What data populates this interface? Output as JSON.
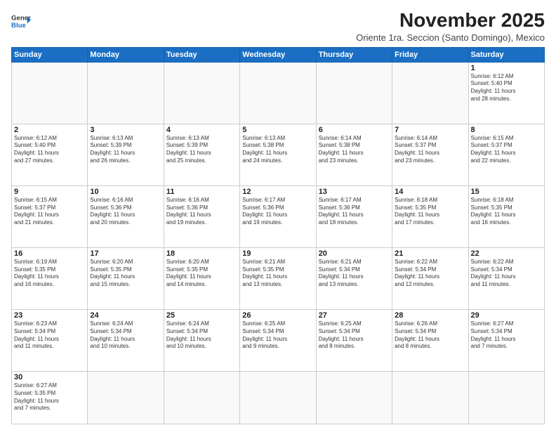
{
  "header": {
    "logo_general": "General",
    "logo_blue": "Blue",
    "title": "November 2025",
    "subtitle": "Oriente 1ra. Seccion (Santo Domingo), Mexico"
  },
  "weekdays": [
    "Sunday",
    "Monday",
    "Tuesday",
    "Wednesday",
    "Thursday",
    "Friday",
    "Saturday"
  ],
  "weeks": [
    [
      {
        "day": "",
        "info": ""
      },
      {
        "day": "",
        "info": ""
      },
      {
        "day": "",
        "info": ""
      },
      {
        "day": "",
        "info": ""
      },
      {
        "day": "",
        "info": ""
      },
      {
        "day": "",
        "info": ""
      },
      {
        "day": "1",
        "info": "Sunrise: 6:12 AM\nSunset: 5:40 PM\nDaylight: 11 hours\nand 28 minutes."
      }
    ],
    [
      {
        "day": "2",
        "info": "Sunrise: 6:12 AM\nSunset: 5:40 PM\nDaylight: 11 hours\nand 27 minutes."
      },
      {
        "day": "3",
        "info": "Sunrise: 6:13 AM\nSunset: 5:39 PM\nDaylight: 11 hours\nand 26 minutes."
      },
      {
        "day": "4",
        "info": "Sunrise: 6:13 AM\nSunset: 5:39 PM\nDaylight: 11 hours\nand 25 minutes."
      },
      {
        "day": "5",
        "info": "Sunrise: 6:13 AM\nSunset: 5:38 PM\nDaylight: 11 hours\nand 24 minutes."
      },
      {
        "day": "6",
        "info": "Sunrise: 6:14 AM\nSunset: 5:38 PM\nDaylight: 11 hours\nand 23 minutes."
      },
      {
        "day": "7",
        "info": "Sunrise: 6:14 AM\nSunset: 5:37 PM\nDaylight: 11 hours\nand 23 minutes."
      },
      {
        "day": "8",
        "info": "Sunrise: 6:15 AM\nSunset: 5:37 PM\nDaylight: 11 hours\nand 22 minutes."
      }
    ],
    [
      {
        "day": "9",
        "info": "Sunrise: 6:15 AM\nSunset: 5:37 PM\nDaylight: 11 hours\nand 21 minutes."
      },
      {
        "day": "10",
        "info": "Sunrise: 6:16 AM\nSunset: 5:36 PM\nDaylight: 11 hours\nand 20 minutes."
      },
      {
        "day": "11",
        "info": "Sunrise: 6:16 AM\nSunset: 5:36 PM\nDaylight: 11 hours\nand 19 minutes."
      },
      {
        "day": "12",
        "info": "Sunrise: 6:17 AM\nSunset: 5:36 PM\nDaylight: 11 hours\nand 19 minutes."
      },
      {
        "day": "13",
        "info": "Sunrise: 6:17 AM\nSunset: 5:36 PM\nDaylight: 11 hours\nand 18 minutes."
      },
      {
        "day": "14",
        "info": "Sunrise: 6:18 AM\nSunset: 5:35 PM\nDaylight: 11 hours\nand 17 minutes."
      },
      {
        "day": "15",
        "info": "Sunrise: 6:18 AM\nSunset: 5:35 PM\nDaylight: 11 hours\nand 16 minutes."
      }
    ],
    [
      {
        "day": "16",
        "info": "Sunrise: 6:19 AM\nSunset: 5:35 PM\nDaylight: 11 hours\nand 16 minutes."
      },
      {
        "day": "17",
        "info": "Sunrise: 6:20 AM\nSunset: 5:35 PM\nDaylight: 11 hours\nand 15 minutes."
      },
      {
        "day": "18",
        "info": "Sunrise: 6:20 AM\nSunset: 5:35 PM\nDaylight: 11 hours\nand 14 minutes."
      },
      {
        "day": "19",
        "info": "Sunrise: 6:21 AM\nSunset: 5:35 PM\nDaylight: 11 hours\nand 13 minutes."
      },
      {
        "day": "20",
        "info": "Sunrise: 6:21 AM\nSunset: 5:34 PM\nDaylight: 11 hours\nand 13 minutes."
      },
      {
        "day": "21",
        "info": "Sunrise: 6:22 AM\nSunset: 5:34 PM\nDaylight: 11 hours\nand 12 minutes."
      },
      {
        "day": "22",
        "info": "Sunrise: 6:22 AM\nSunset: 5:34 PM\nDaylight: 11 hours\nand 11 minutes."
      }
    ],
    [
      {
        "day": "23",
        "info": "Sunrise: 6:23 AM\nSunset: 5:34 PM\nDaylight: 11 hours\nand 11 minutes."
      },
      {
        "day": "24",
        "info": "Sunrise: 6:24 AM\nSunset: 5:34 PM\nDaylight: 11 hours\nand 10 minutes."
      },
      {
        "day": "25",
        "info": "Sunrise: 6:24 AM\nSunset: 5:34 PM\nDaylight: 11 hours\nand 10 minutes."
      },
      {
        "day": "26",
        "info": "Sunrise: 6:25 AM\nSunset: 5:34 PM\nDaylight: 11 hours\nand 9 minutes."
      },
      {
        "day": "27",
        "info": "Sunrise: 6:25 AM\nSunset: 5:34 PM\nDaylight: 11 hours\nand 8 minutes."
      },
      {
        "day": "28",
        "info": "Sunrise: 6:26 AM\nSunset: 5:34 PM\nDaylight: 11 hours\nand 8 minutes."
      },
      {
        "day": "29",
        "info": "Sunrise: 6:27 AM\nSunset: 5:34 PM\nDaylight: 11 hours\nand 7 minutes."
      }
    ],
    [
      {
        "day": "30",
        "info": "Sunrise: 6:27 AM\nSunset: 5:35 PM\nDaylight: 11 hours\nand 7 minutes."
      },
      {
        "day": "",
        "info": ""
      },
      {
        "day": "",
        "info": ""
      },
      {
        "day": "",
        "info": ""
      },
      {
        "day": "",
        "info": ""
      },
      {
        "day": "",
        "info": ""
      },
      {
        "day": "",
        "info": ""
      }
    ]
  ]
}
